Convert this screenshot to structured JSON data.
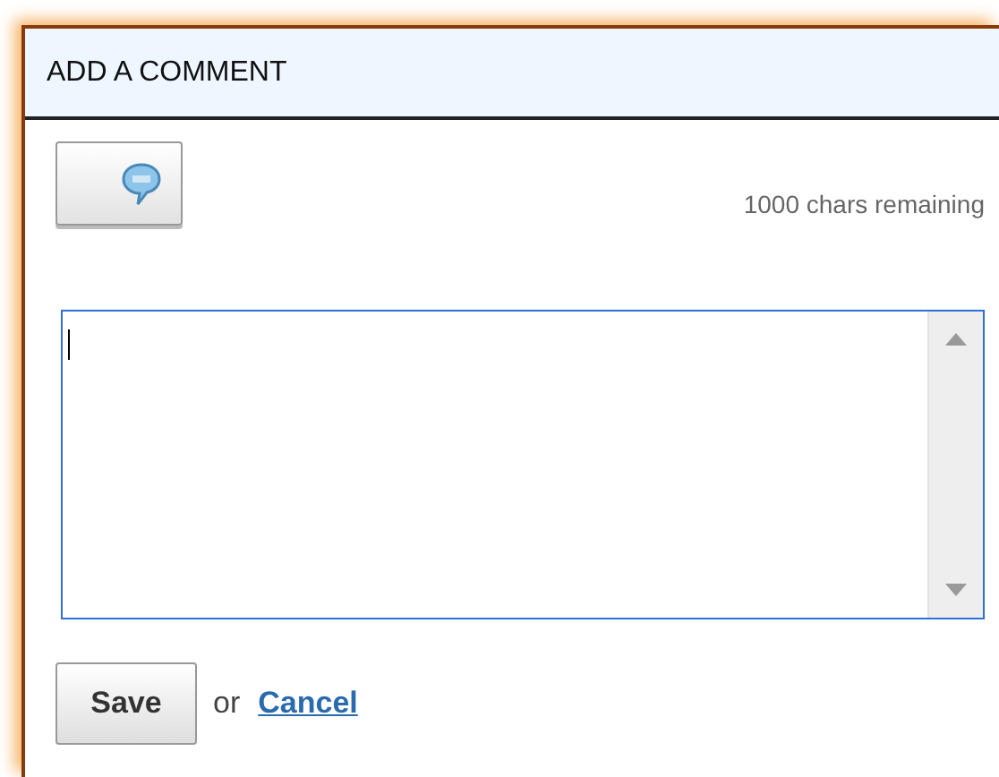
{
  "panel": {
    "title": "ADD A COMMENT"
  },
  "chars_remaining": "1000 chars remaining",
  "comment_field": {
    "focused": true
  },
  "actions": {
    "save": "Save",
    "separator": "or",
    "cancel": "Cancel"
  }
}
